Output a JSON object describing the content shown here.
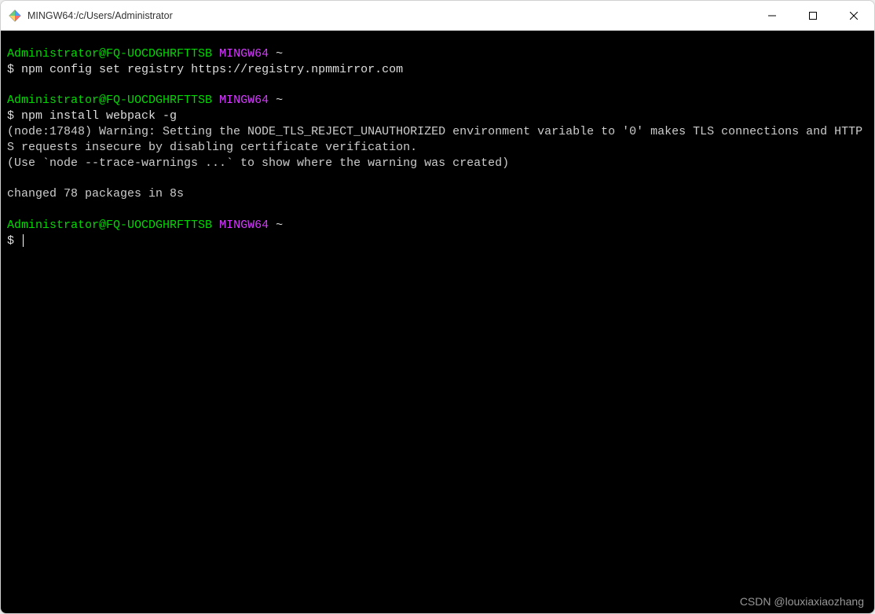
{
  "window": {
    "title": "MINGW64:/c/Users/Administrator"
  },
  "prompt": {
    "userhost": "Administrator@FQ-UOCDGHRFTTSB",
    "shell": "MINGW64",
    "path": "~",
    "dollar": "$"
  },
  "session": {
    "cmd1": "npm config set registry https://registry.npmmirror.com",
    "cmd2": "npm install webpack -g",
    "out1": "(node:17848) Warning: Setting the NODE_TLS_REJECT_UNAUTHORIZED environment variable to '0' makes TLS connections and HTTPS requests insecure by disabling certificate verification.",
    "out2": "(Use `node --trace-warnings ...` to show where the warning was created)",
    "out3": "changed 78 packages in 8s"
  },
  "watermark": "CSDN @louxiaxiaozhang"
}
